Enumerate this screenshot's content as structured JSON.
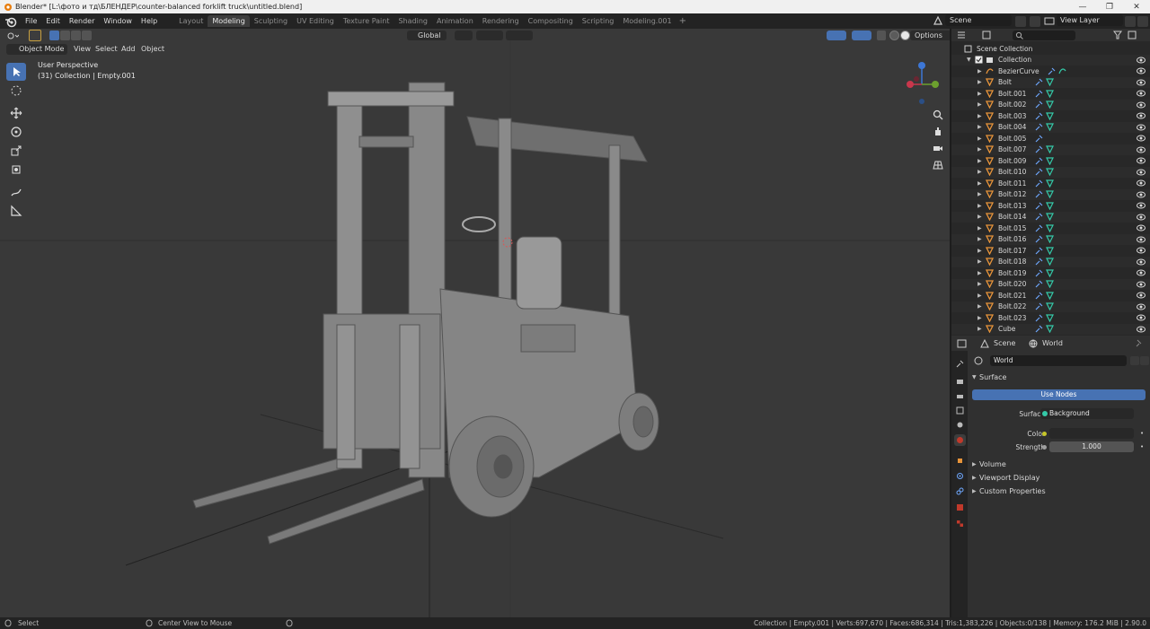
{
  "window": {
    "title": "Blender* [L:\\фото и тд\\БЛЕНДЕР\\counter-balanced forklift truck\\untitled.blend]",
    "controls": [
      "—",
      "❐",
      "✕"
    ]
  },
  "menus": [
    "File",
    "Edit",
    "Render",
    "Window",
    "Help"
  ],
  "workspaces": [
    {
      "label": "Layout",
      "active": false
    },
    {
      "label": "Modeling",
      "active": true
    },
    {
      "label": "Sculpting",
      "active": false
    },
    {
      "label": "UV Editing",
      "active": false
    },
    {
      "label": "Texture Paint",
      "active": false
    },
    {
      "label": "Shading",
      "active": false
    },
    {
      "label": "Animation",
      "active": false
    },
    {
      "label": "Rendering",
      "active": false
    },
    {
      "label": "Compositing",
      "active": false
    },
    {
      "label": "Scripting",
      "active": false
    },
    {
      "label": "Modeling.001",
      "active": false
    }
  ],
  "workspace_add": "+",
  "scene_name": "Scene",
  "view_layer": "View Layer",
  "viewport": {
    "mode": "Object Mode",
    "menus": [
      "View",
      "Select",
      "Add",
      "Object"
    ],
    "perspective": "User Perspective",
    "collection_info": "(31) Collection | Empty.001",
    "transform": "Global",
    "options": "Options"
  },
  "outliner": {
    "root": "Scene Collection",
    "collection": "Collection",
    "items": [
      "BezierCurve",
      "Bolt",
      "Bolt.001",
      "Bolt.002",
      "Bolt.003",
      "Bolt.004",
      "Bolt.005",
      "Bolt.007",
      "Bolt.009",
      "Bolt.010",
      "Bolt.011",
      "Bolt.012",
      "Bolt.013",
      "Bolt.014",
      "Bolt.015",
      "Bolt.016",
      "Bolt.017",
      "Bolt.018",
      "Bolt.019",
      "Bolt.020",
      "Bolt.021",
      "Bolt.022",
      "Bolt.023",
      "Cube"
    ]
  },
  "properties": {
    "scene_tab": "Scene",
    "world_tab": "World",
    "world_name": "World",
    "surface_panel": "Surface",
    "use_nodes": "Use Nodes",
    "surface_label": "Surface",
    "surface_value": "Background",
    "color_label": "Color",
    "strength_label": "Strength",
    "strength_value": "1.000",
    "panels": [
      "Volume",
      "Viewport Display",
      "Custom Properties"
    ]
  },
  "status": {
    "left": "Select",
    "mid": "Center View to Mouse",
    "right": "Collection | Empty.001 | Verts:697,670 | Faces:686,314 | Tris:1,383,226 | Objects:0/138 | Memory: 176.2 MiB | 2.90.0"
  },
  "colors": {
    "accent": "#4772b3",
    "viewport_bg": "#393939",
    "mesh_icon": "#e8943a",
    "data_icon": "#34c9a8",
    "modifier_icon": "#6fa8ff"
  }
}
